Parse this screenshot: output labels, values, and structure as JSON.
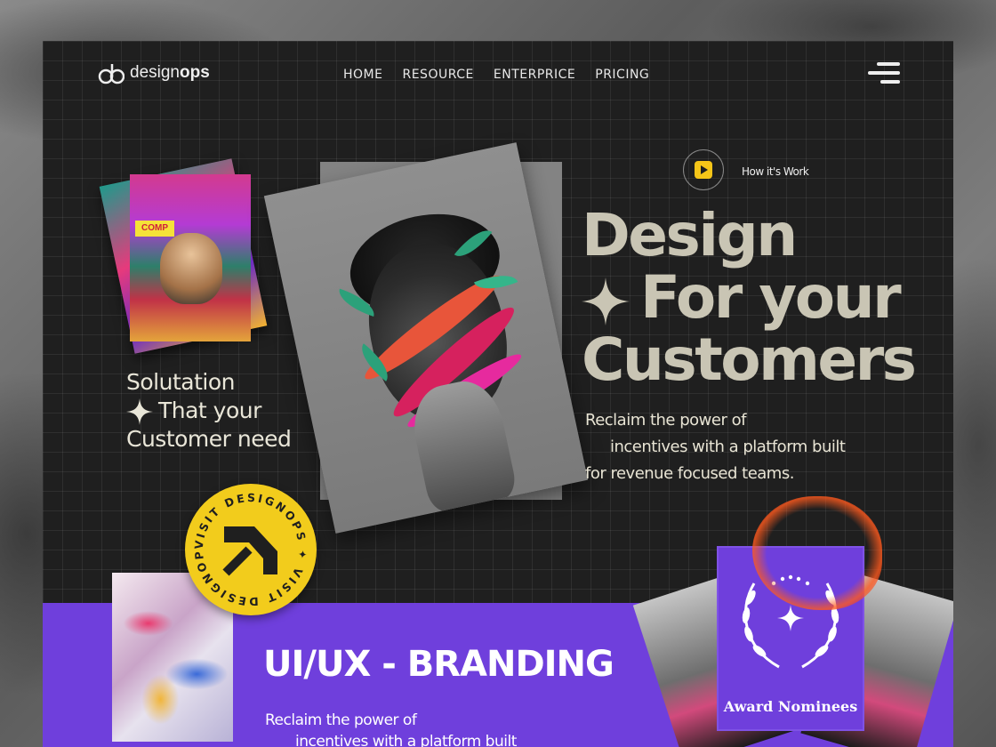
{
  "brand": {
    "name_prefix": "design",
    "name_suffix": "ops"
  },
  "nav": {
    "items": [
      "HOME",
      "RESOURCE",
      "ENTERPRICE",
      "PRICING"
    ]
  },
  "poster_tag": "COMP",
  "left_tagline": {
    "line1": "Solutation",
    "line2": "That your",
    "line3": "Customer need"
  },
  "how_it_works": "How it's Work",
  "hero": {
    "line1": "Design",
    "line2": "For your",
    "line3": "Customers",
    "desc_line1": "Reclaim the power of",
    "desc_line2": "incentives with a platform built",
    "desc_line3": "for revenue  focused teams."
  },
  "badge": {
    "ring_text": "VISIT DESIGNOPS ✦ VISIT DESIGNOPS ✦"
  },
  "band": {
    "title": "UI/UX - BRANDING",
    "desc_line1": "Reclaim the power of",
    "desc_line2": "incentives with a platform built"
  },
  "award": {
    "label": "Award Nominees"
  },
  "colors": {
    "accent_purple": "#6f3fdc",
    "badge_yellow": "#f2cc1c",
    "play_yellow": "#f5c518",
    "frame_dark": "#1f1f1f",
    "headline": "#c9c5b4"
  }
}
